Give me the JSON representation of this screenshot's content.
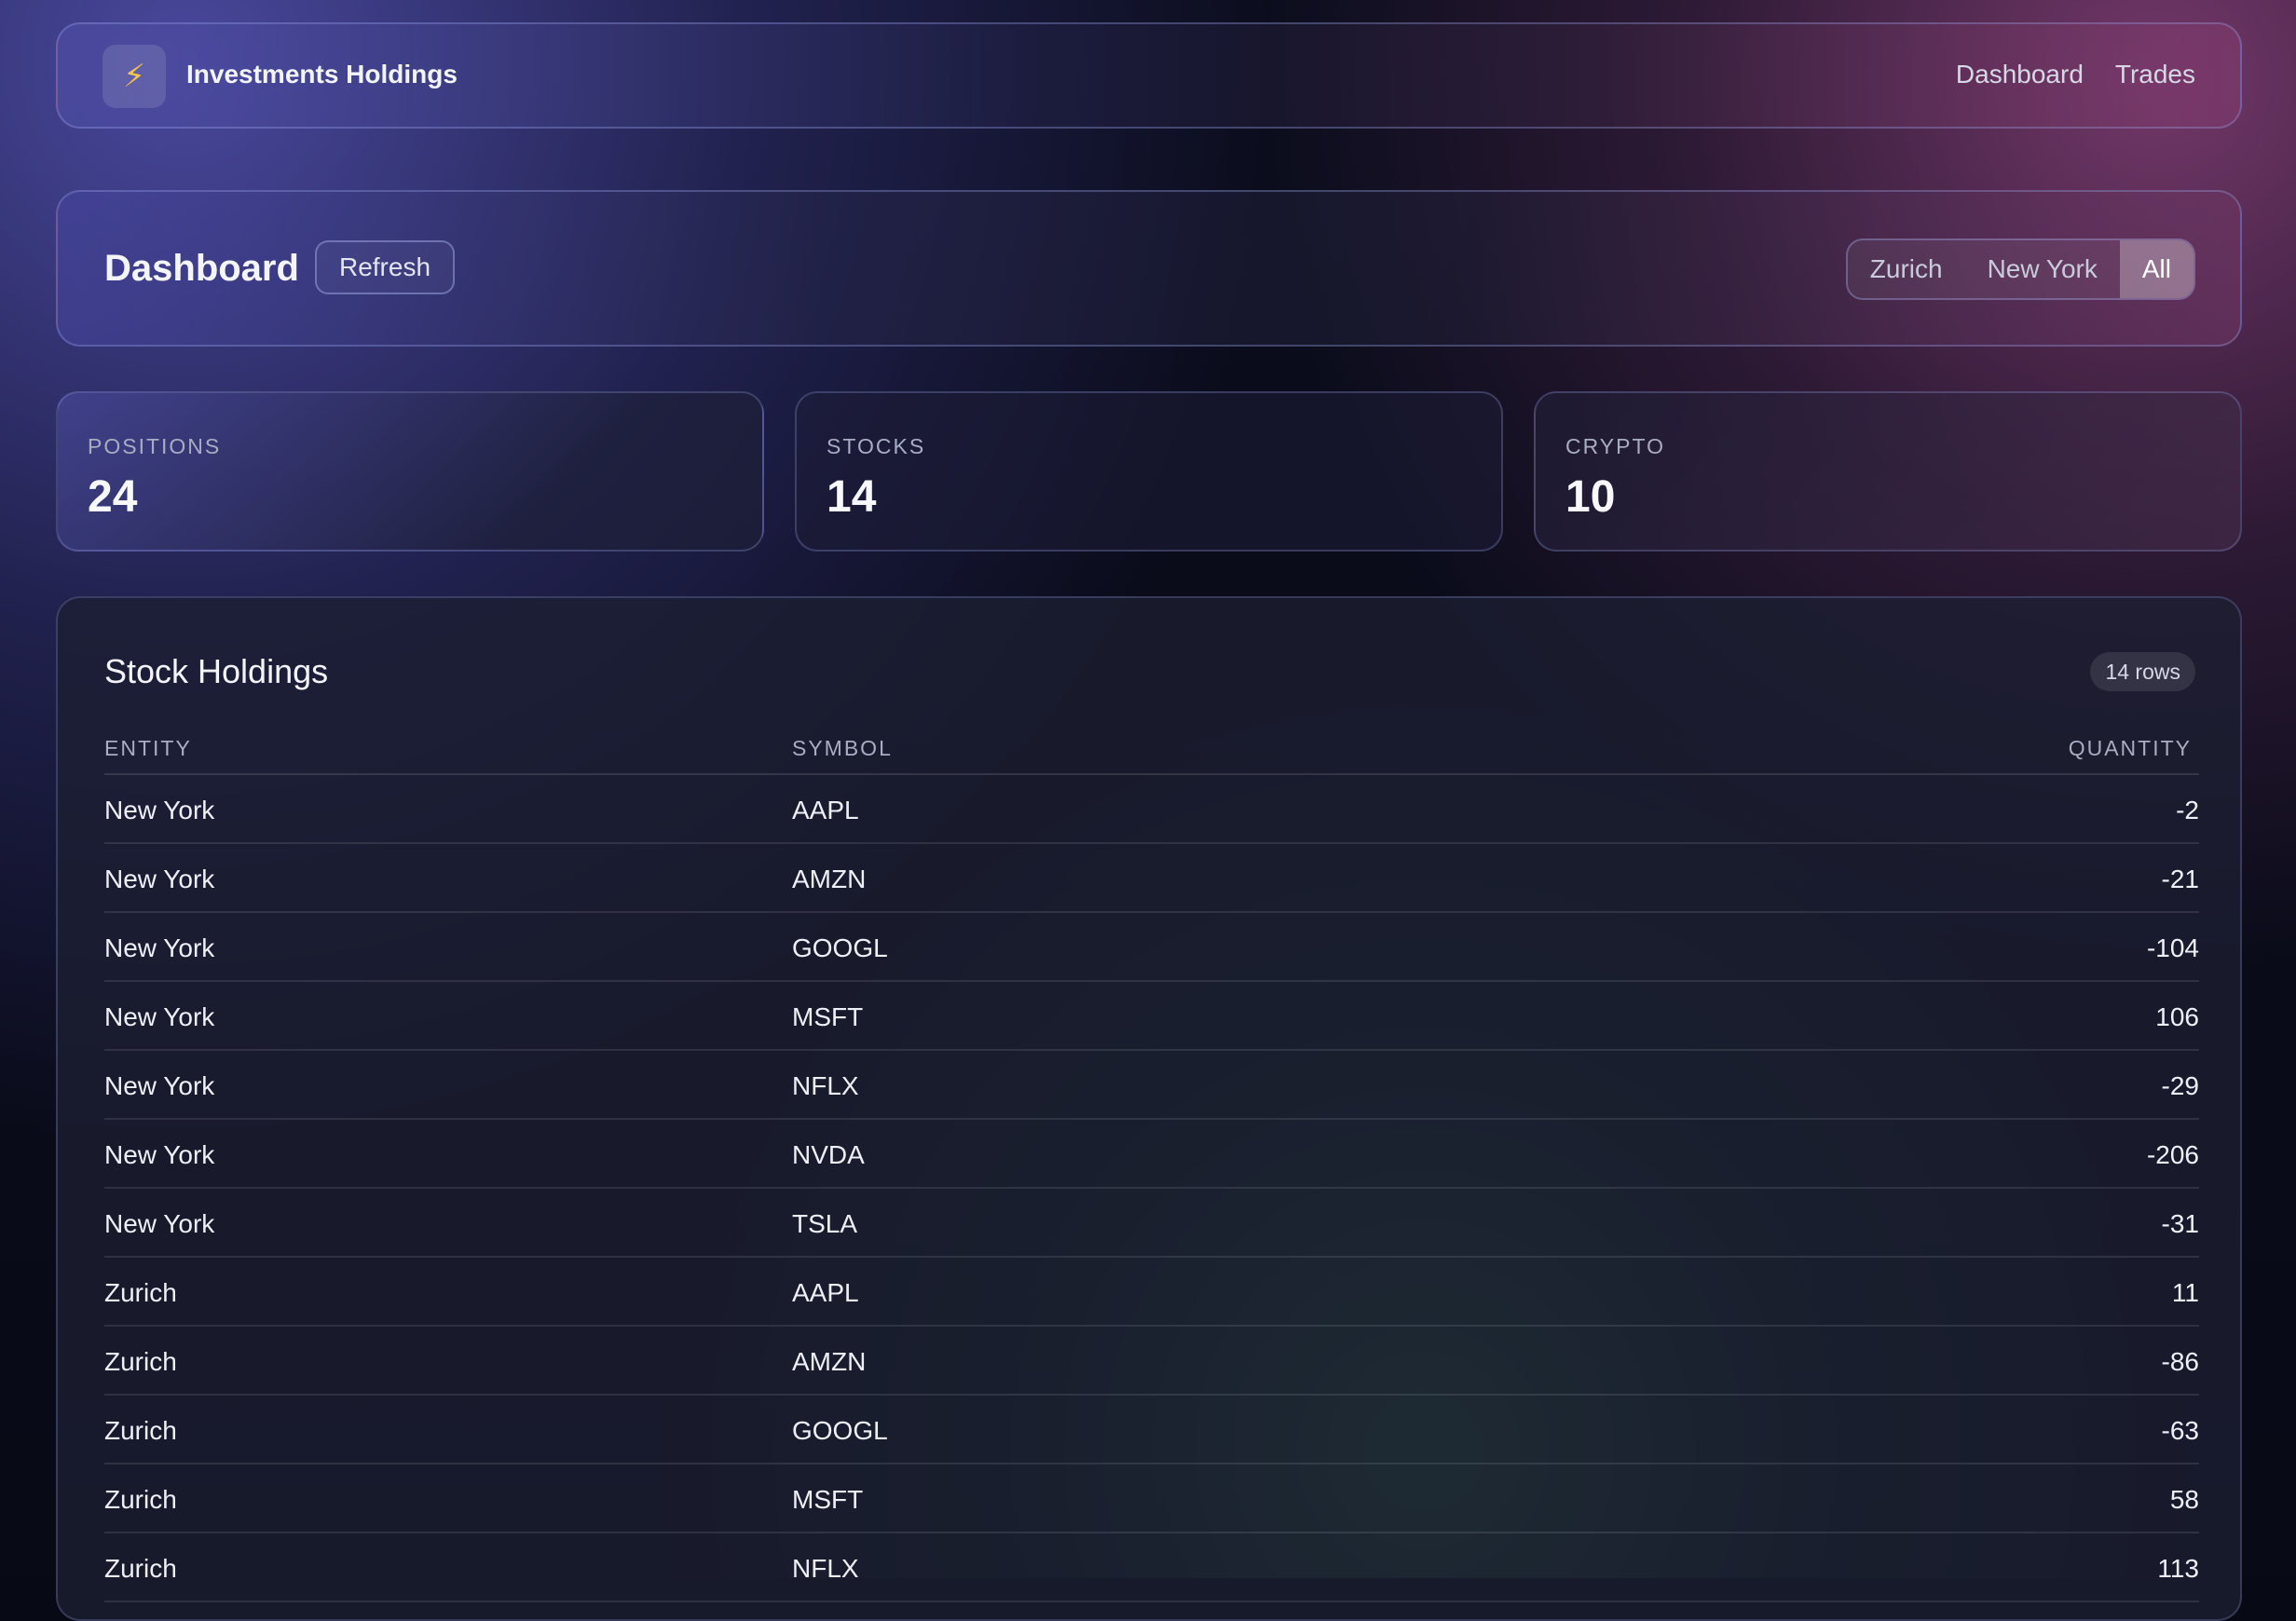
{
  "header": {
    "app_title": "Investments Holdings",
    "logo_icon": "lightning-icon",
    "nav": [
      "Dashboard",
      "Trades"
    ]
  },
  "dashboard": {
    "title": "Dashboard",
    "refresh_label": "Refresh",
    "filter": {
      "options": [
        "Zurich",
        "New York",
        "All"
      ],
      "selected": "All"
    }
  },
  "stats": [
    {
      "label": "POSITIONS",
      "value": "24"
    },
    {
      "label": "STOCKS",
      "value": "14"
    },
    {
      "label": "CRYPTO",
      "value": "10"
    }
  ],
  "holdings": {
    "title": "Stock Holdings",
    "row_count": "14 rows",
    "columns": [
      "ENTITY",
      "SYMBOL",
      "QUANTITY"
    ],
    "rows": [
      {
        "entity": "New York",
        "symbol": "AAPL",
        "quantity": "-2"
      },
      {
        "entity": "New York",
        "symbol": "AMZN",
        "quantity": "-21"
      },
      {
        "entity": "New York",
        "symbol": "GOOGL",
        "quantity": "-104"
      },
      {
        "entity": "New York",
        "symbol": "MSFT",
        "quantity": "106"
      },
      {
        "entity": "New York",
        "symbol": "NFLX",
        "quantity": "-29"
      },
      {
        "entity": "New York",
        "symbol": "NVDA",
        "quantity": "-206"
      },
      {
        "entity": "New York",
        "symbol": "TSLA",
        "quantity": "-31"
      },
      {
        "entity": "Zurich",
        "symbol": "AAPL",
        "quantity": "11"
      },
      {
        "entity": "Zurich",
        "symbol": "AMZN",
        "quantity": "-86"
      },
      {
        "entity": "Zurich",
        "symbol": "GOOGL",
        "quantity": "-63"
      },
      {
        "entity": "Zurich",
        "symbol": "MSFT",
        "quantity": "58"
      },
      {
        "entity": "Zurich",
        "symbol": "NFLX",
        "quantity": "113"
      }
    ]
  }
}
